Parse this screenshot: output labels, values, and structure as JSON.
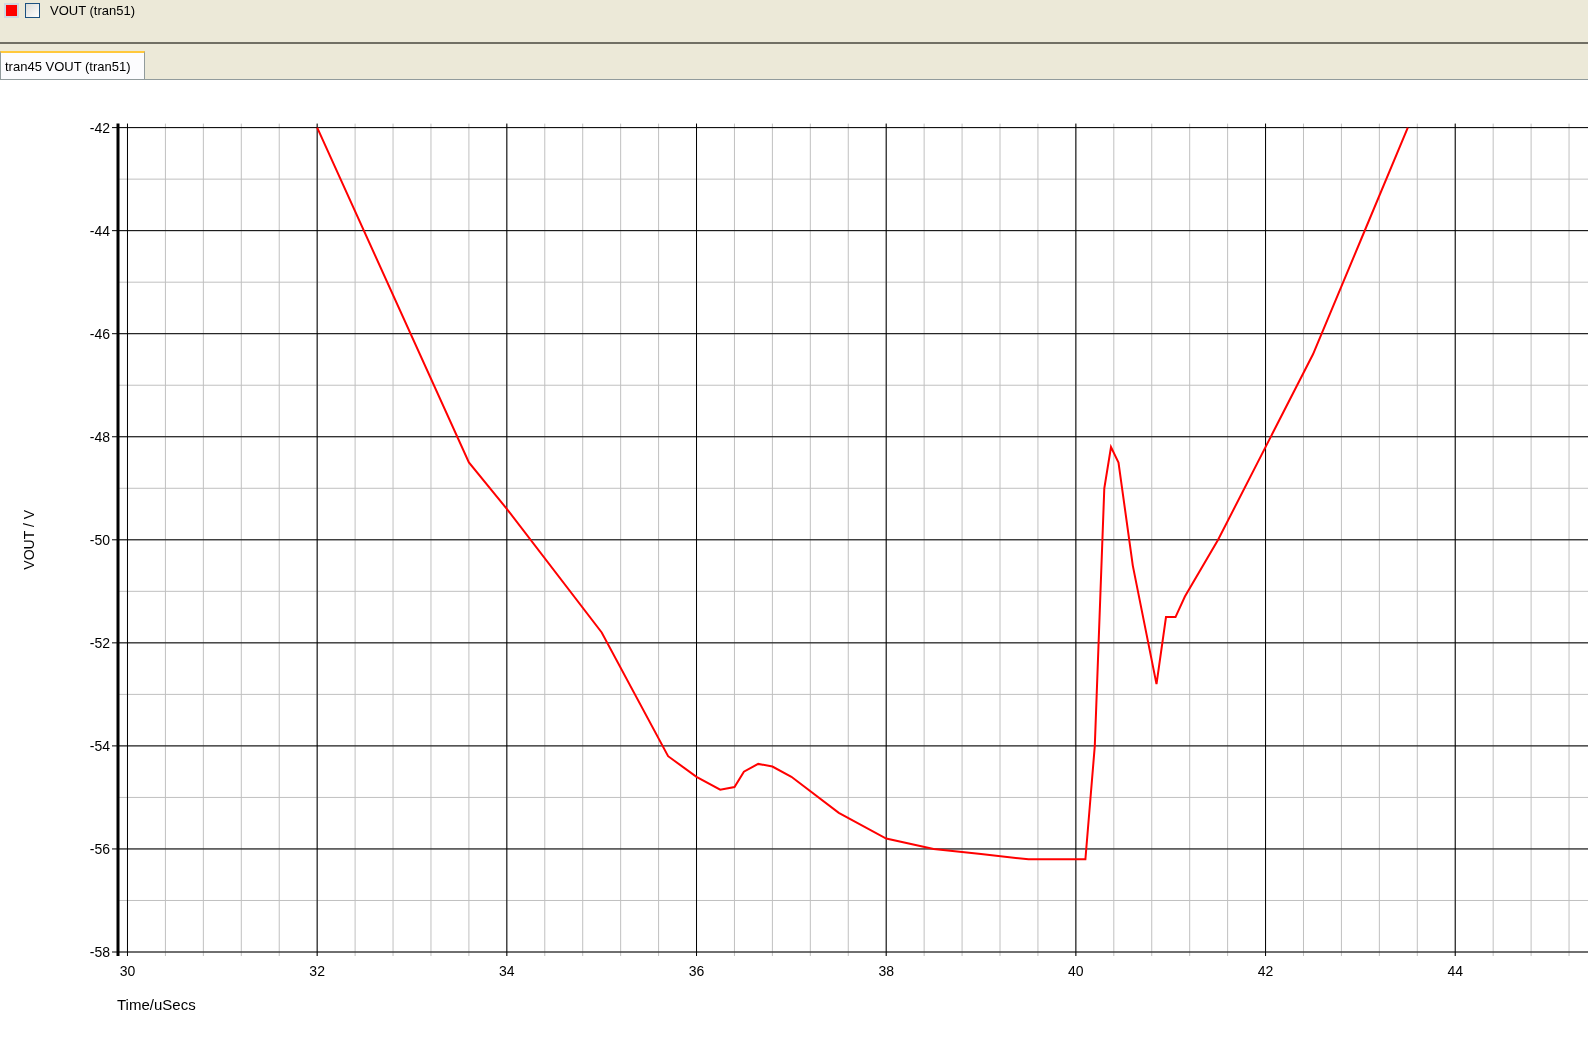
{
  "legend": {
    "color": "#ff0000",
    "checked": false,
    "label": "VOUT (tran51)"
  },
  "tabs": [
    {
      "label": "tran45 VOUT (tran51)",
      "selected": true
    }
  ],
  "chart_data": {
    "type": "line",
    "xlabel": "Time/uSecs",
    "ylabel": "VOUT / V",
    "xlim": [
      29.9,
      45.4
    ],
    "ylim": [
      -58,
      -42
    ],
    "xticks": [
      30,
      32,
      34,
      36,
      38,
      40,
      42,
      44
    ],
    "yticks": [
      -42,
      -44,
      -46,
      -48,
      -50,
      -52,
      -54,
      -56,
      -58
    ],
    "grid": true,
    "x": [
      32,
      33.6,
      34,
      35,
      35.7,
      36,
      36.25,
      36.4,
      36.5,
      36.65,
      36.8,
      37,
      37.5,
      38,
      38.5,
      39,
      39.5,
      40.1,
      40.2,
      40.3,
      40.37,
      40.45,
      40.6,
      40.85,
      40.95,
      41.05,
      41.15,
      41.5,
      42,
      42.5,
      43,
      43.5
    ],
    "series": [
      {
        "color": "#ff0000",
        "values": [
          -42,
          -48.5,
          -49.4,
          -51.8,
          -54.2,
          -54.6,
          -54.85,
          -54.8,
          -54.5,
          -54.35,
          -54.4,
          -54.6,
          -55.3,
          -55.8,
          -56,
          -56.1,
          -56.2,
          -56.2,
          -54,
          -49,
          -48.2,
          -48.5,
          -50.5,
          -52.8,
          -51.5,
          -51.5,
          -51.1,
          -50,
          -48.2,
          -46.4,
          -44.2,
          -42
        ]
      }
    ]
  }
}
